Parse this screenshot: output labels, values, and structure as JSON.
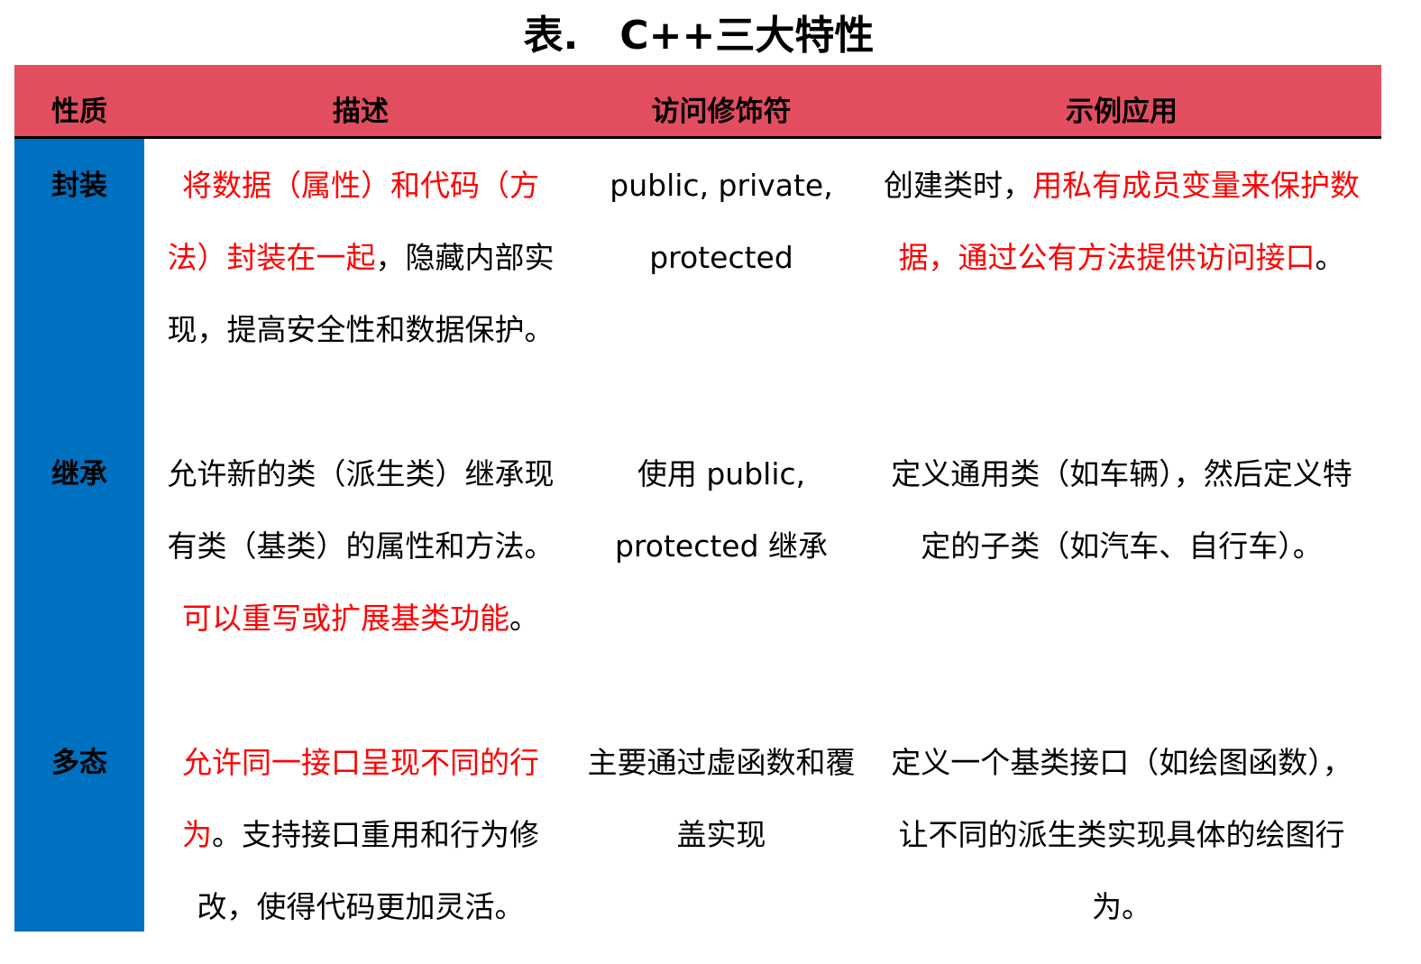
{
  "title": "表.   C++三大特性",
  "colors": {
    "header_bg": "#E24E60",
    "label_col_bg": "#0070C0",
    "highlight_text": "#FF0000"
  },
  "headers": [
    "性质",
    "描述",
    "访问修饰符",
    "示例应用"
  ],
  "rows": [
    {
      "label": "封装",
      "desc": [
        {
          "text": "将数据（属性）和代码（方法）封装在一起",
          "red": true
        },
        {
          "text": "，隐藏内部实现，提高安全性和数据保护。",
          "red": false
        }
      ],
      "access": "public, private, protected",
      "example": [
        {
          "text": "创建类时，",
          "red": false
        },
        {
          "text": "用私有成员变量来保护数据，通过公有方法提供访问接口",
          "red": true
        },
        {
          "text": "。",
          "red": false
        }
      ]
    },
    {
      "label": "继承",
      "desc": [
        {
          "text": "允许新的类（派生类）继承现有类（基类）的属性和方法。",
          "red": false
        },
        {
          "text": "可以重写或扩展基类功能",
          "red": true
        },
        {
          "text": "。",
          "red": false
        }
      ],
      "access": "使用 public, protected 继承",
      "example": [
        {
          "text": "定义通用类（如车辆），然后定义特定的子类（如汽车、自行车）。",
          "red": false
        }
      ]
    },
    {
      "label": "多态",
      "desc": [
        {
          "text": "允许同一接口呈现不同的行为",
          "red": true
        },
        {
          "text": "。支持接口重用和行为修改，使得代码更加灵活。",
          "red": false
        }
      ],
      "access": "主要通过虚函数和覆盖实现",
      "example": [
        {
          "text": "定义一个基类接口（如绘图函数），让不同的派生类实现具体的绘图行为。",
          "red": false
        }
      ]
    }
  ]
}
